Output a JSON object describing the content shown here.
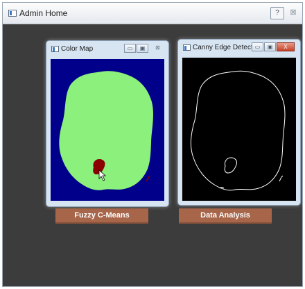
{
  "window": {
    "title": "Admin Home",
    "help_label": "?",
    "close_label": "⊠"
  },
  "color_map": {
    "title": "Color Map",
    "controls": {
      "minimize": "▭",
      "maximize": "▣",
      "close": "⊠"
    },
    "colors": {
      "background": "#00008b",
      "region": "#8cf07c",
      "lesion": "#8b0000"
    }
  },
  "canny": {
    "title": "Canny Edge Detector",
    "controls": {
      "minimize": "▭",
      "maximize": "▣",
      "close": "X"
    },
    "colors": {
      "background": "#000000",
      "edge": "#ffffff"
    }
  },
  "buttons": {
    "fcm": "Fuzzy C-Means",
    "analysis": "Data Analysis"
  },
  "colors": {
    "workspace": "#3c3c3c",
    "button": "#a7664a"
  }
}
